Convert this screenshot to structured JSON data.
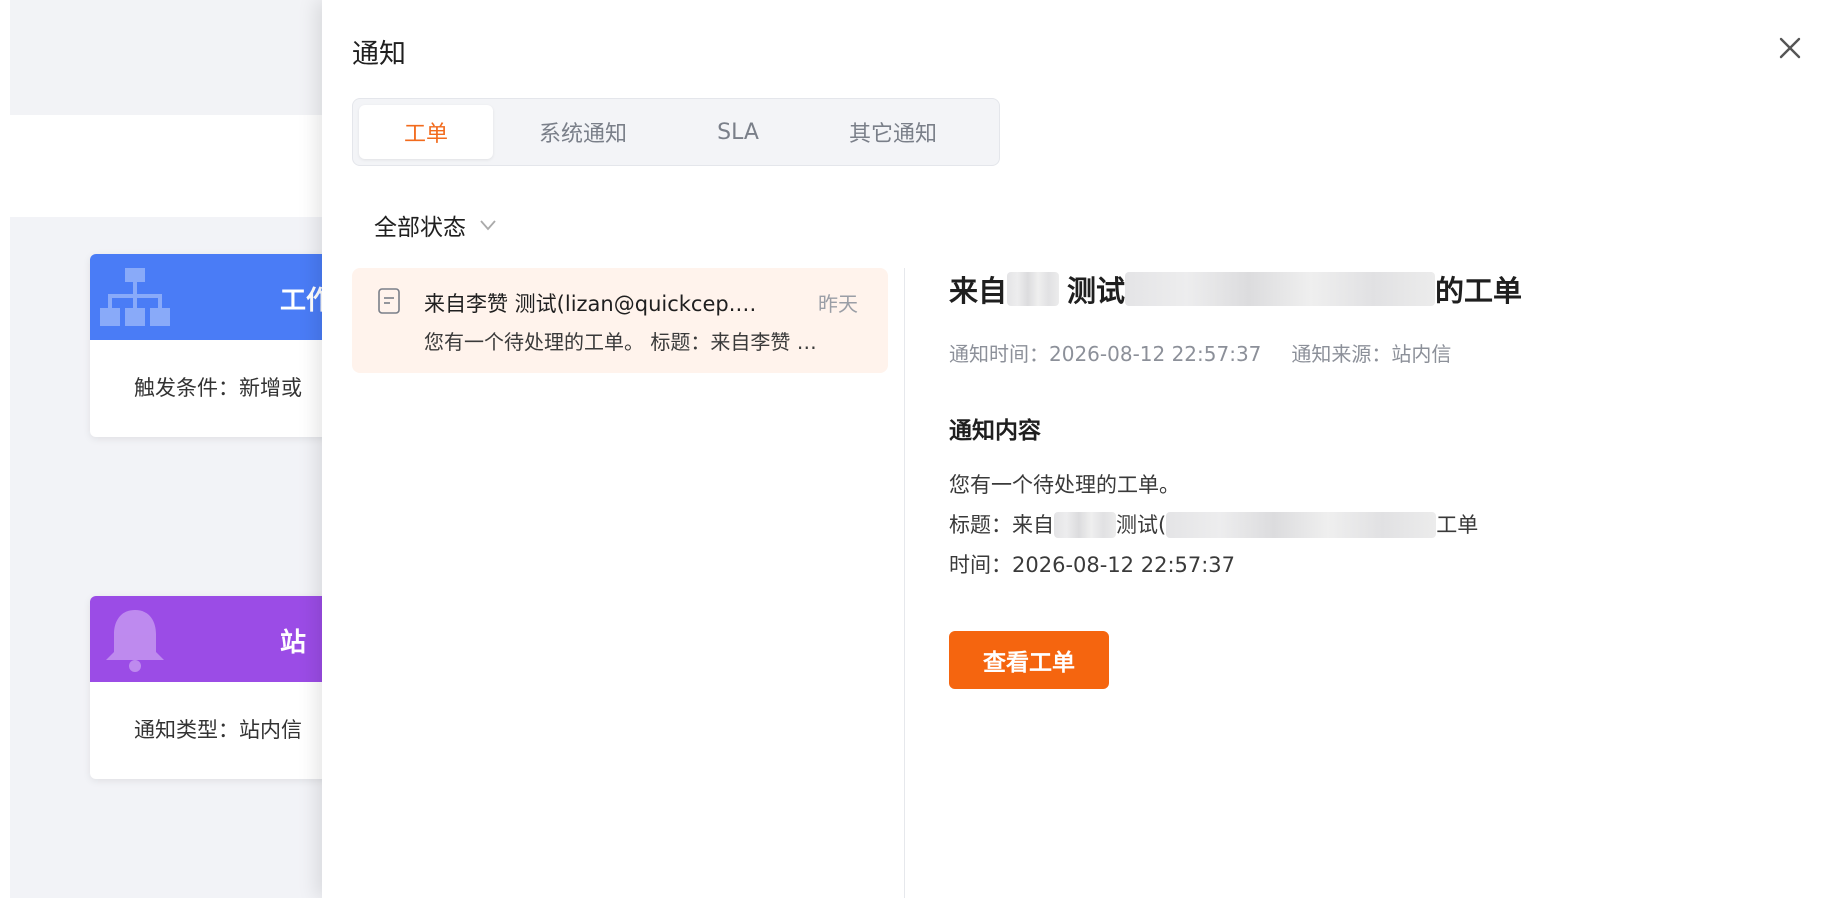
{
  "background": {
    "card1": {
      "title": "工作",
      "label": "触发条件：新增或"
    },
    "card2": {
      "title": "站",
      "label": "通知类型：站内信"
    },
    "colors": {
      "card1_header": "#4a7cf6",
      "card2_header": "#9b4ce6"
    }
  },
  "drawer": {
    "title": "通知",
    "tabs": [
      {
        "label": "工单",
        "active": true
      },
      {
        "label": "系统通知",
        "active": false
      },
      {
        "label": "SLA",
        "active": false
      },
      {
        "label": "其它通知",
        "active": false
      }
    ],
    "status_filter": "全部状态",
    "list": [
      {
        "title": "来自李赞 测试(lizan@quickcep.com)的工单",
        "time": "昨天",
        "desc": "您有一个待处理的工单。 标题：来自李赞 测试(lizan@quickcep.com)的工单"
      }
    ],
    "detail": {
      "title_prefix": "来自",
      "title_mid": "测试",
      "title_suffix": "的工单",
      "notify_time": "通知时间：2026-08-12 22:57:37",
      "notify_source": "通知来源：站内信",
      "section_title": "通知内容",
      "body_line1": "您有一个待处理的工单。",
      "body_line2_prefix": "标题：来自",
      "body_line2_mid": "测试(",
      "body_line2_suffix": "工单",
      "body_line3": "时间：2026-08-12 22:57:37",
      "button_label": "查看工单"
    },
    "colors": {
      "accent": "#f5650f",
      "tab_active": "#f26b1d",
      "selected_row": "#fff3ec"
    }
  }
}
